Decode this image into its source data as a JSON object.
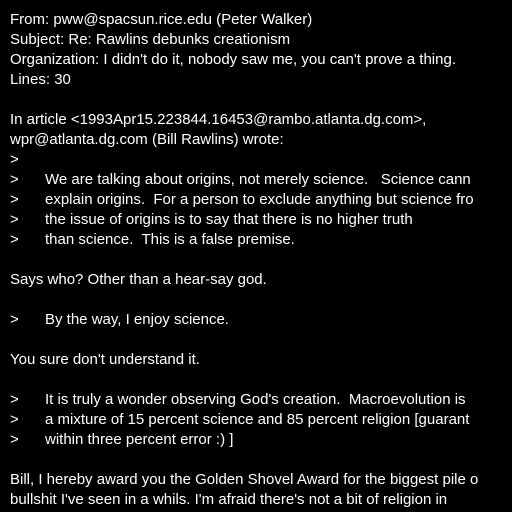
{
  "colors": {
    "background": "#000000",
    "text": "#ffffff"
  },
  "header": {
    "from": "From: pww@spacsun.rice.edu (Peter Walker)",
    "subject": "Subject: Re: Rawlins debunks creationism",
    "organization": "Organization: I didn't do it, nobody saw me, you can't prove a thing.",
    "lines": "Lines: 30"
  },
  "body": {
    "attribution_1": "In article <1993Apr15.223844.16453@rambo.atlanta.dg.com>,",
    "attribution_2": "wpr@atlanta.dg.com (Bill Rawlins) wrote:",
    "quote_marker": ">",
    "quote1": [
      "We are talking about origins, not merely science.   Science cann",
      "explain origins.  For a person to exclude anything but science fro",
      "the issue of origins is to say that there is no higher truth",
      "than science.  This is a false premise."
    ],
    "reply1": "Says who? Other than a hear-say god.",
    "quote2": "By the way, I enjoy science.",
    "reply2": "You sure don't understand it.",
    "quote3": [
      "It is truly a wonder observing God's creation.  Macroevolution is",
      "a mixture of 15 percent science and 85 percent religion [guarant",
      "within three percent error :) ]"
    ],
    "reply3": [
      "Bill, I hereby award you the Golden Shovel Award for the biggest pile o",
      "bullshit I've seen in a whils. I'm afraid there's not a bit of religion in"
    ]
  }
}
